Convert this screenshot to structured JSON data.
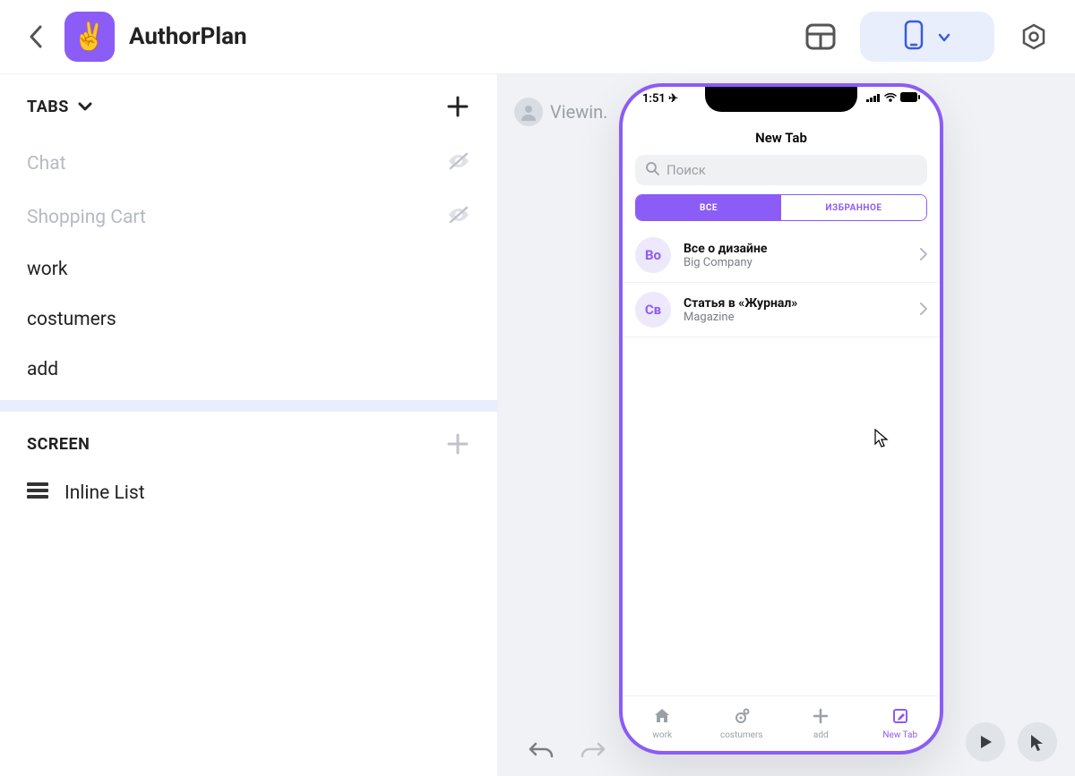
{
  "header": {
    "app_icon": "✌️",
    "title": "AuthorPlan"
  },
  "sidebar": {
    "tabs_label": "TABS",
    "items": [
      {
        "label": "Chat",
        "disabled": true,
        "hidden": true
      },
      {
        "label": "Shopping Cart",
        "disabled": true,
        "hidden": true
      },
      {
        "label": "work",
        "disabled": false,
        "hidden": false
      },
      {
        "label": "costumers",
        "disabled": false,
        "hidden": false
      },
      {
        "label": "add",
        "disabled": false,
        "hidden": false
      }
    ],
    "screen_label": "SCREEN",
    "screen_item": "Inline List"
  },
  "canvas": {
    "viewing_label": "Viewin."
  },
  "phone": {
    "time": "1:51",
    "screen_title": "New Tab",
    "search_placeholder": "Поиск",
    "segments": [
      {
        "label": "ВСЕ",
        "active": true
      },
      {
        "label": "ИЗБРАННОЕ",
        "active": false
      }
    ],
    "list": [
      {
        "avatar": "Во",
        "title": "Все о дизайне",
        "subtitle": "Big Company"
      },
      {
        "avatar": "Св",
        "title": "Статья в «Журнал»",
        "subtitle": "Magazine"
      }
    ],
    "tabs": [
      {
        "label": "work",
        "icon": "home",
        "active": false
      },
      {
        "label": "costumers",
        "icon": "gear",
        "active": false
      },
      {
        "label": "add",
        "icon": "plus",
        "active": false
      },
      {
        "label": "New Tab",
        "icon": "edit",
        "active": true
      }
    ]
  }
}
